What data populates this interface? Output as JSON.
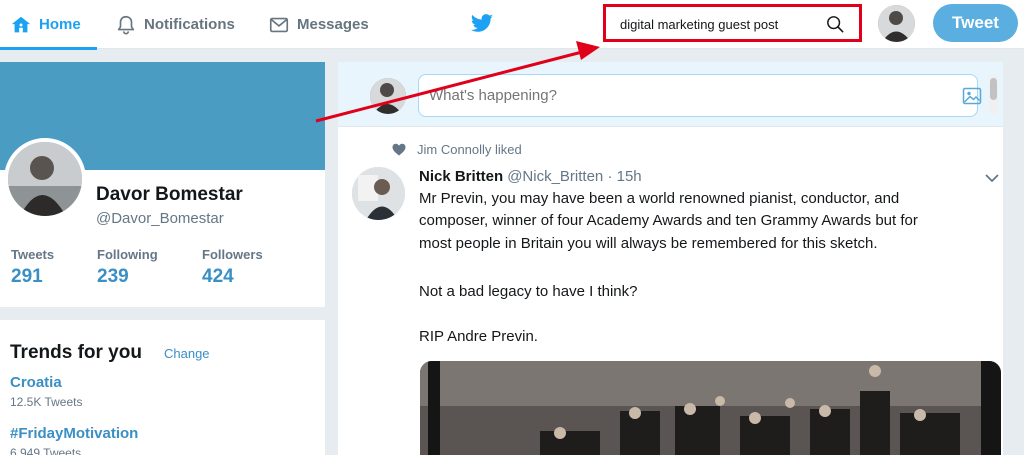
{
  "nav": {
    "home": "Home",
    "notifications": "Notifications",
    "messages": "Messages",
    "tweet_button": "Tweet"
  },
  "search": {
    "value": "digital marketing guest post"
  },
  "profile": {
    "name": "Davor Bomestar",
    "handle": "@Davor_Bomestar",
    "stats": [
      {
        "label": "Tweets",
        "value": "291"
      },
      {
        "label": "Following",
        "value": "239"
      },
      {
        "label": "Followers",
        "value": "424"
      }
    ]
  },
  "trends": {
    "title": "Trends for you",
    "change": "Change",
    "items": [
      {
        "name": "Croatia",
        "count": "12.5K Tweets"
      },
      {
        "name": "#FridayMotivation",
        "count": "6,949 Tweets"
      }
    ]
  },
  "composer": {
    "placeholder": "What's happening?"
  },
  "tweet": {
    "liked_by": "Jim Connolly liked",
    "author": "Nick Britten",
    "meta": "@Nick_Britten · 15h",
    "lines": [
      "Mr Previn, you may have been a world renowned  pianist, conductor, and",
      "composer, winner of four Academy Awards  and ten Grammy Awards but for",
      "most people in Britain you will always be remembered for this sketch.",
      "Not a bad legacy to have I think?",
      "RIP Andre Previn."
    ]
  },
  "colors": {
    "accent": "#1da1f2",
    "banner": "#4a9cc3",
    "annotation": "#e0001a"
  }
}
